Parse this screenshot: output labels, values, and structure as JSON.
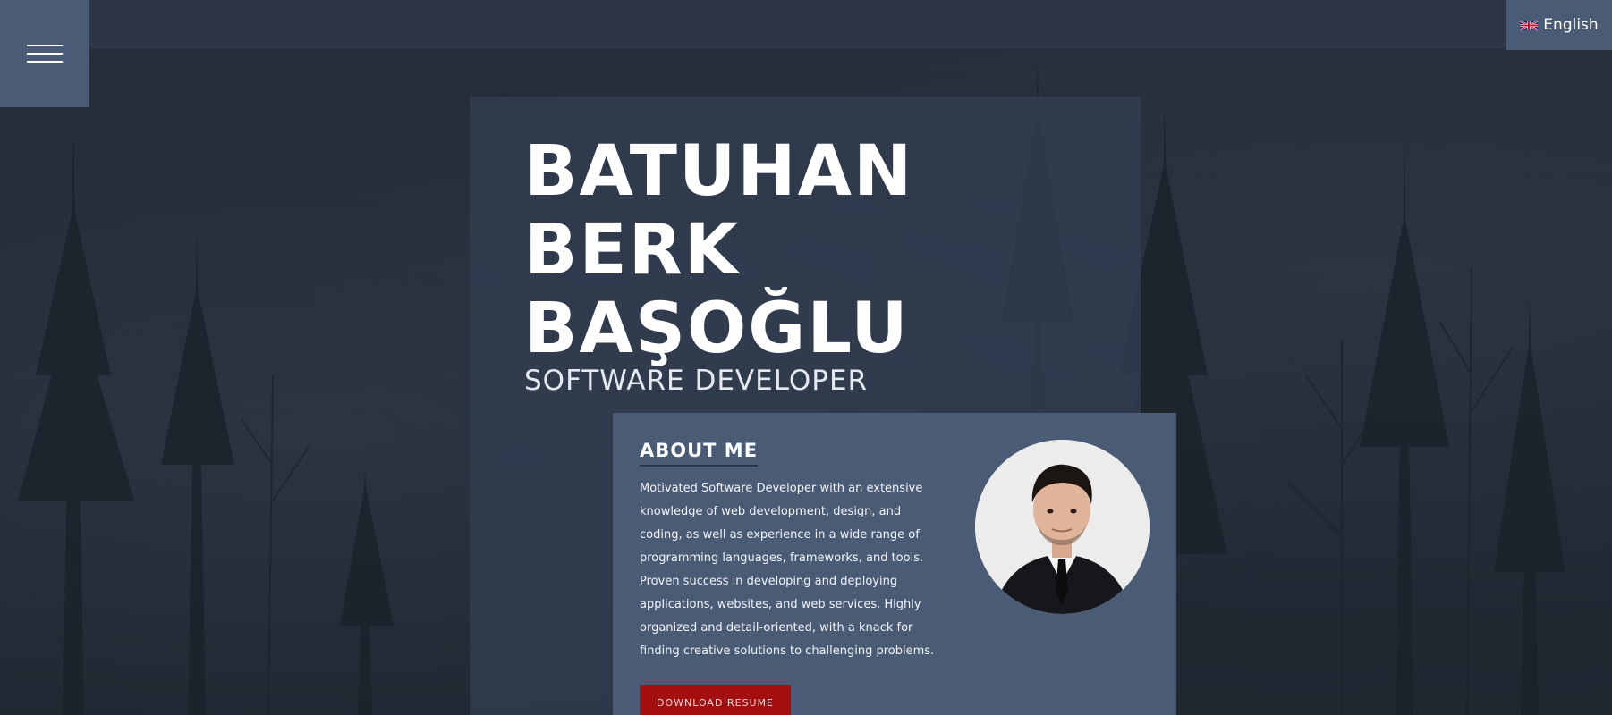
{
  "header": {
    "menu_icon": "hamburger-menu-icon",
    "language": {
      "label": "English",
      "flag_icon": "uk-flag-icon"
    }
  },
  "hero": {
    "name_lines": [
      "BATUHAN",
      "BERK",
      "BAŞOĞLU"
    ],
    "role": "SOFTWARE DEVELOPER"
  },
  "about": {
    "title": "ABOUT ME",
    "text": "Motivated Software Developer with an extensive knowledge of web development, design, and coding, as well as experience in a wide range of programming languages, frameworks, and tools. Proven success in developing and deploying applications, websites, and web services. Highly organized and detail-oriented, with a knack for finding creative solutions to challenging problems.",
    "download_label": "DOWNLOAD RESUME"
  },
  "colors": {
    "background": "#232a35",
    "topbar": "#2c3646",
    "accent_panel": "#4a5b76",
    "download_button": "#a30f0f"
  }
}
